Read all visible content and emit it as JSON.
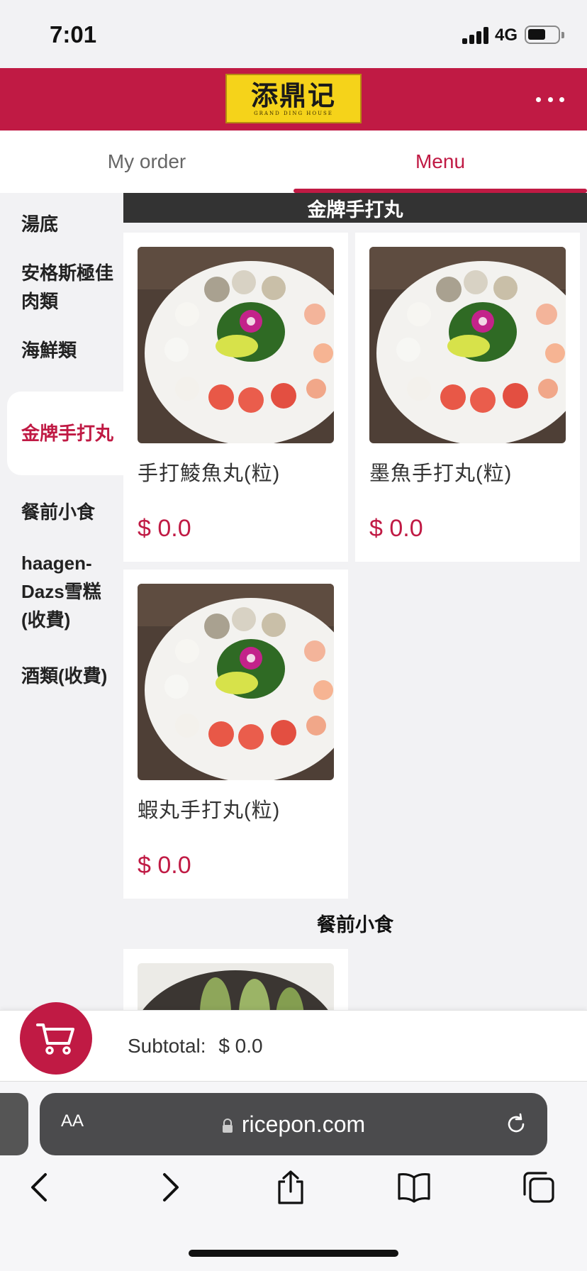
{
  "status_bar": {
    "time": "7:01",
    "network": "4G"
  },
  "header": {
    "logo_text": "添鼎记",
    "logo_subtext": "GRAND DING HOUSE"
  },
  "tabs": [
    {
      "label": "My order",
      "active": false
    },
    {
      "label": "Menu",
      "active": true
    }
  ],
  "sidebar": {
    "items": [
      {
        "label": "湯底",
        "active": false
      },
      {
        "label": "安格斯極佳肉類",
        "active": false
      },
      {
        "label": "海鮮類",
        "active": false
      },
      {
        "label": "金牌手打丸",
        "active": true
      },
      {
        "label": "餐前小食",
        "active": false
      },
      {
        "label": "haagen-Dazs雪糕(收費)",
        "active": false
      },
      {
        "label": "酒類(收費)",
        "active": false
      }
    ]
  },
  "menu": {
    "current_section": "金牌手打丸",
    "items": [
      {
        "name": "手打鯪魚丸(粒)",
        "price": "$ 0.0"
      },
      {
        "name": "墨魚手打丸(粒)",
        "price": "$ 0.0"
      },
      {
        "name": "蝦丸手打丸(粒)",
        "price": "$ 0.0"
      }
    ],
    "next_section": "餐前小食"
  },
  "cart": {
    "subtotal_label": "Subtotal:",
    "subtotal_value": "$ 0.0"
  },
  "browser": {
    "aa_label": "AA",
    "url": "ricepon.com"
  },
  "colors": {
    "brand": "#c01a44",
    "logo_bg": "#f5d31a"
  }
}
